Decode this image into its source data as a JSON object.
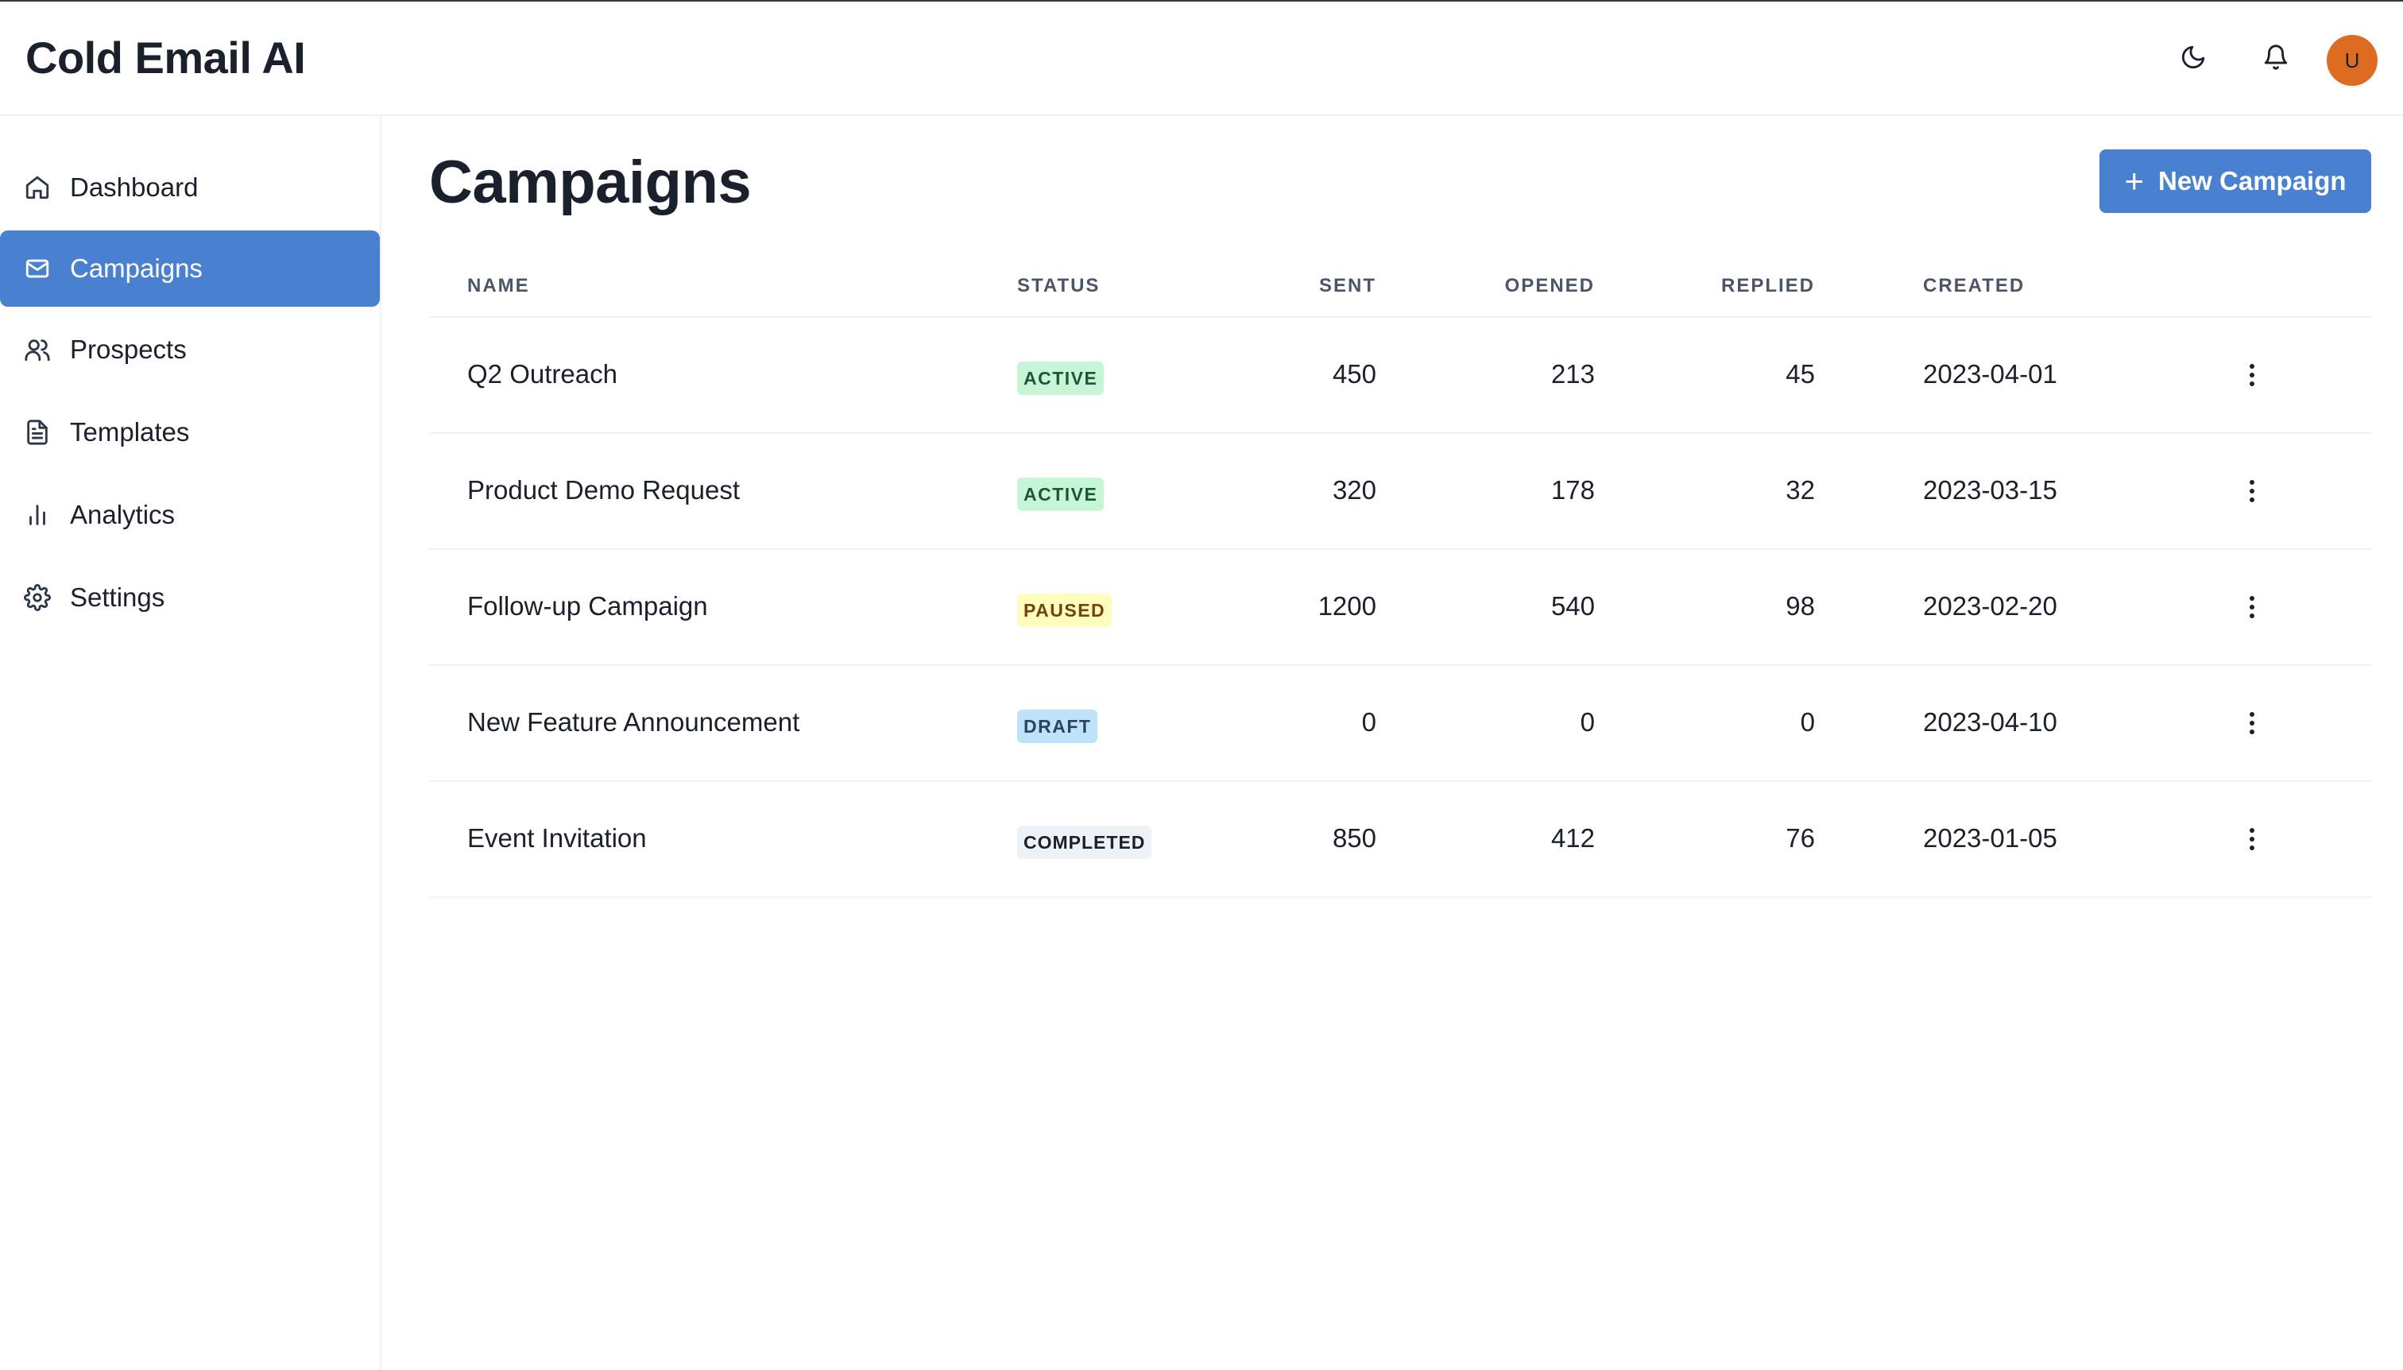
{
  "app": {
    "title": "Cold Email AI"
  },
  "header": {
    "theme_icon": "moon-icon",
    "notifications_icon": "bell-icon",
    "avatar_initial": "U",
    "avatar_color": "#dd6b20"
  },
  "sidebar": {
    "items": [
      {
        "label": "Dashboard",
        "icon": "home-icon",
        "active": false
      },
      {
        "label": "Campaigns",
        "icon": "mail-icon",
        "active": true
      },
      {
        "label": "Prospects",
        "icon": "users-icon",
        "active": false
      },
      {
        "label": "Templates",
        "icon": "file-text-icon",
        "active": false
      },
      {
        "label": "Analytics",
        "icon": "bar-chart-icon",
        "active": false
      },
      {
        "label": "Settings",
        "icon": "gear-icon",
        "active": false
      }
    ]
  },
  "main": {
    "title": "Campaigns",
    "new_button_label": "New Campaign",
    "accent_color": "#4a80d0"
  },
  "table": {
    "columns": [
      "Name",
      "Status",
      "Sent",
      "Opened",
      "Replied",
      "Created"
    ],
    "rows": [
      {
        "name": "Q2 Outreach",
        "status": "ACTIVE",
        "sent": "450",
        "opened": "213",
        "replied": "45",
        "created": "2023-04-01"
      },
      {
        "name": "Product Demo Request",
        "status": "ACTIVE",
        "sent": "320",
        "opened": "178",
        "replied": "32",
        "created": "2023-03-15"
      },
      {
        "name": "Follow-up Campaign",
        "status": "PAUSED",
        "sent": "1200",
        "opened": "540",
        "replied": "98",
        "created": "2023-02-20"
      },
      {
        "name": "New Feature Announcement",
        "status": "DRAFT",
        "sent": "0",
        "opened": "0",
        "replied": "0",
        "created": "2023-04-10"
      },
      {
        "name": "Event Invitation",
        "status": "COMPLETED",
        "sent": "850",
        "opened": "412",
        "replied": "76",
        "created": "2023-01-05"
      }
    ]
  }
}
